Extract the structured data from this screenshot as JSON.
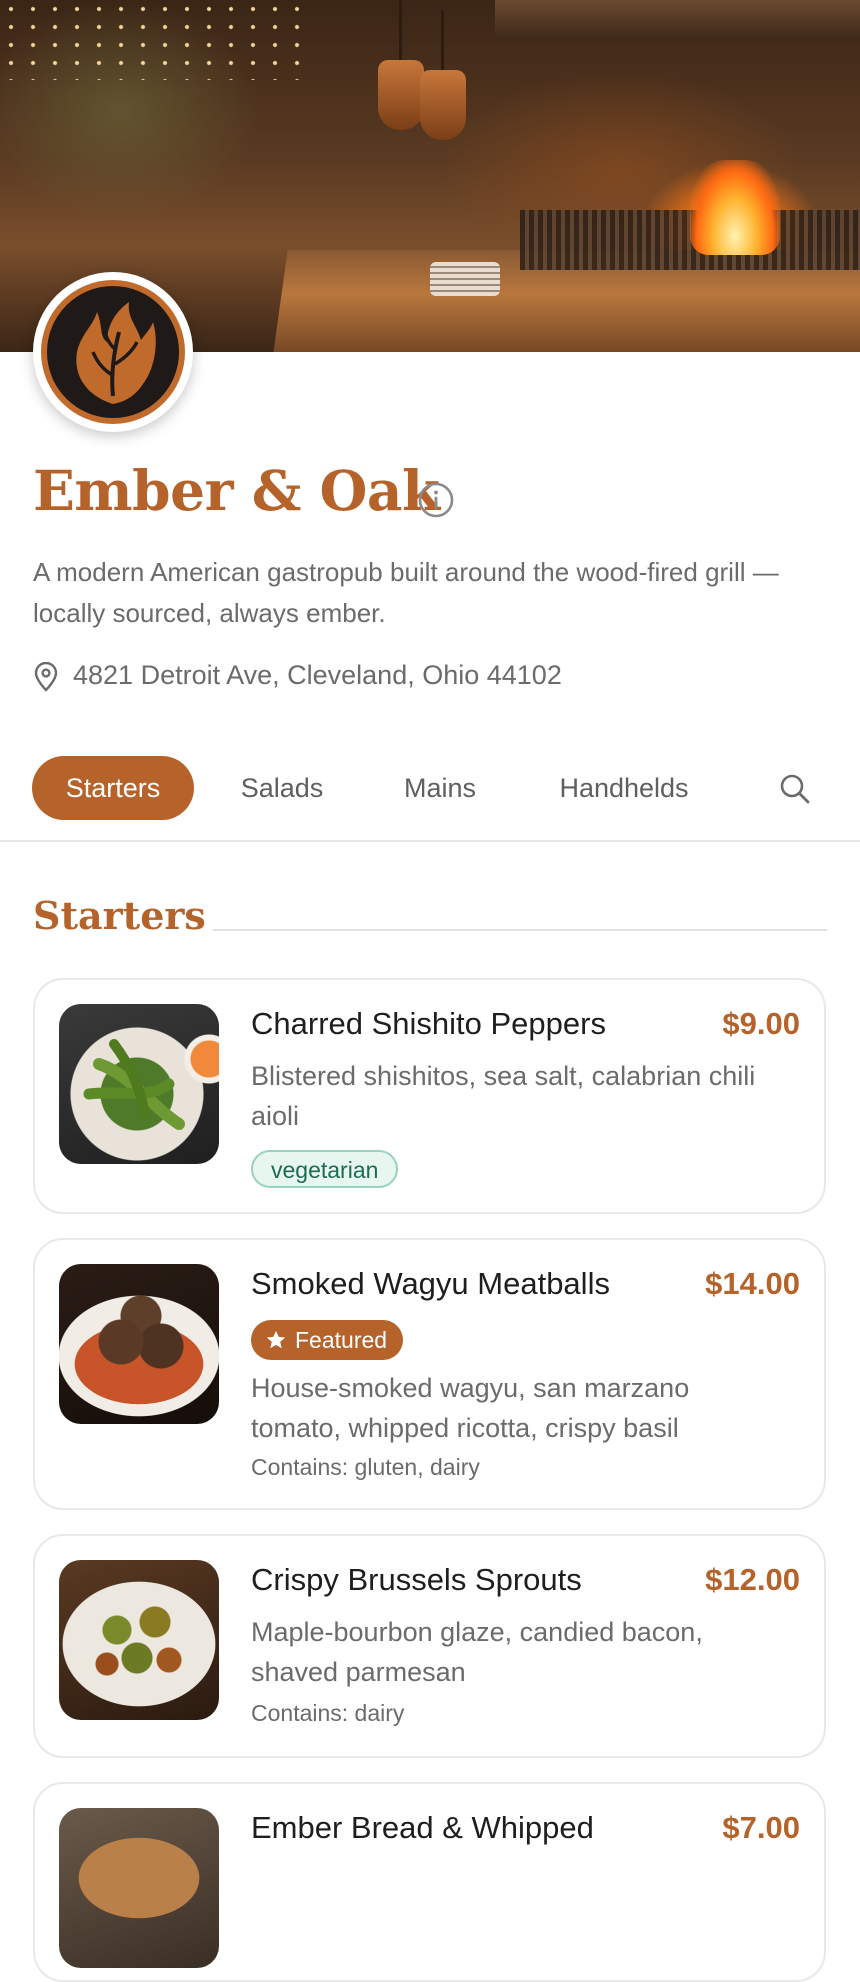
{
  "restaurant": {
    "name": "Ember & Oak",
    "description": "A modern American gastropub built around the wood-fired grill — locally sourced, always ember.",
    "address": "4821 Detroit Ave, Cleveland, Ohio 44102"
  },
  "tabs": [
    {
      "label": "Starters",
      "active": true
    },
    {
      "label": "Salads",
      "active": false
    },
    {
      "label": "Mains",
      "active": false
    },
    {
      "label": "Handhelds",
      "active": false
    }
  ],
  "section": {
    "title": "Starters"
  },
  "items": [
    {
      "name": "Charred Shishito Peppers",
      "price": "$9.00",
      "description": "Blistered shishitos, sea salt, calabrian chili aioli",
      "tag": "vegetarian"
    },
    {
      "name": "Smoked Wagyu Meatballs",
      "price": "$14.00",
      "badge": "Featured",
      "description": "House-smoked wagyu, san marzano tomato, whipped ricotta, crispy basil",
      "allergens": "Contains: gluten, dairy"
    },
    {
      "name": "Crispy Brussels Sprouts",
      "price": "$12.00",
      "description": "Maple-bourbon glaze, candied bacon, shaved parmesan",
      "allergens": "Contains: dairy"
    },
    {
      "name": "Ember Bread & Whipped",
      "price": "$7.00"
    }
  ],
  "colors": {
    "accent": "#b5632a",
    "text": "#1e1e1e",
    "muted": "#6b6b6b",
    "veg_bg": "#e8f6f0",
    "veg_text": "#1c6b52"
  },
  "icons": [
    "info-icon",
    "map-pin-icon",
    "search-icon",
    "star-icon",
    "flame-leaf-logo"
  ]
}
